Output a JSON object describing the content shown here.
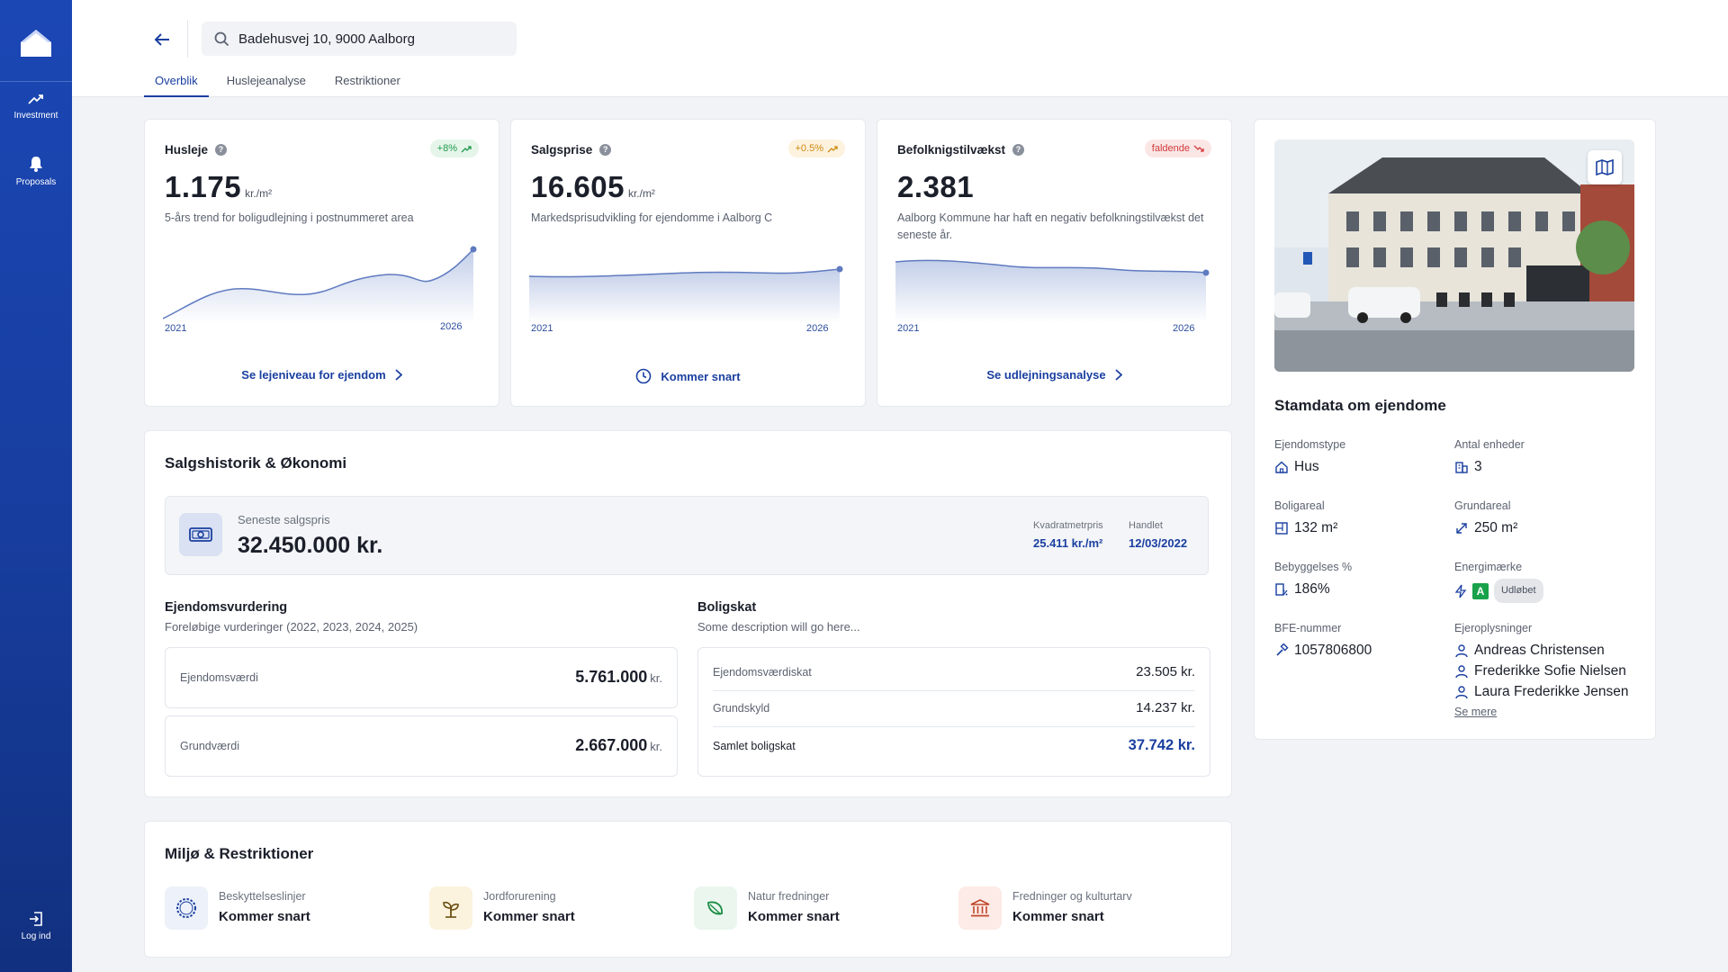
{
  "sidebar": {
    "items": [
      {
        "label": "Investment",
        "icon": "trend-up-icon"
      },
      {
        "label": "Proposals",
        "icon": "bell-icon"
      }
    ],
    "logout_label": "Log ind"
  },
  "header": {
    "search_value": "Badehusvej 10, 9000 Aalborg",
    "tabs": [
      "Overblik",
      "Huslejeanalyse",
      "Restriktioner"
    ],
    "active_tab": "Overblik"
  },
  "kpis": [
    {
      "title": "Husleje",
      "badge": "+8%",
      "badge_color": "#1f9a4a",
      "badge_bg": "#e5f5ea",
      "value": "1.175",
      "unit": "kr./m²",
      "desc": "5-års trend for boligudlejning i postnummeret area",
      "year_start": "2021",
      "year_end": "2026",
      "link": "Se lejeniveau for ejendom"
    },
    {
      "title": "Salgsprise",
      "badge": "+0.5%",
      "badge_color": "#d08a10",
      "badge_bg": "#fcf2de",
      "value": "16.605",
      "unit": "kr./m²",
      "desc": "Markedsprisudvikling for ejendomme i Aalborg C",
      "year_start": "2021",
      "year_end": "2026",
      "link": "Kommer snart"
    },
    {
      "title": "Befolknigstilvækst",
      "badge": "faldende",
      "badge_color": "#d23b3b",
      "badge_bg": "#fbe6e6",
      "value": "2.381",
      "unit": "",
      "desc": "Aalborg Kommune har haft en negativ befolkningstilvækst det seneste år.",
      "year_start": "2021",
      "year_end": "2026",
      "link": "Se udlejningsanalyse"
    }
  ],
  "sales": {
    "title": "Salgshistorik & Økonomi",
    "latest_label": "Seneste salgspris",
    "latest_value": "32.450.000 kr.",
    "sqm_label": "Kvadratmetrpris",
    "sqm_value": "25.411 kr./m²",
    "traded_label": "Handlet",
    "traded_value": "12/03/2022",
    "valuation": {
      "title": "Ejendomsvurdering",
      "desc": "Foreløbige vurderinger (2022, 2023, 2024, 2025)",
      "rows": [
        {
          "label": "Ejendomsværdi",
          "value": "5.761.000",
          "unit": "kr."
        },
        {
          "label": "Grundværdi",
          "value": "2.667.000",
          "unit": "kr."
        }
      ]
    },
    "tax": {
      "title": "Boligskat",
      "desc": "Some description will go here...",
      "rows": [
        {
          "label": "Ejendomsværdiskat",
          "value": "23.505 kr."
        },
        {
          "label": "Grundskyld",
          "value": "14.237 kr."
        }
      ],
      "total_label": "Samlet boligskat",
      "total_value": "37.742 kr."
    }
  },
  "environment": {
    "title": "Miljø & Restriktioner",
    "items": [
      {
        "label": "Beskyttelseslinjer",
        "value": "Kommer snart",
        "icon": "protection-line-icon"
      },
      {
        "label": "Jordforurening",
        "value": "Kommer snart",
        "icon": "sprout-icon"
      },
      {
        "label": "Natur fredninger",
        "value": "Kommer snart",
        "icon": "leaf-icon"
      },
      {
        "label": "Fredninger og kulturtarv",
        "value": "Kommer snart",
        "icon": "museum-icon"
      }
    ]
  },
  "property": {
    "title": "Stamdata om ejendome",
    "attrs": [
      {
        "label": "Ejendomstype",
        "value": "Hus",
        "icon": "house-icon"
      },
      {
        "label": "Antal enheder",
        "value": "3",
        "icon": "building-icon"
      },
      {
        "label": "Boligareal",
        "value": "132 m²",
        "icon": "floorplan-icon"
      },
      {
        "label": "Grundareal",
        "value": "250 m²",
        "icon": "resize-icon"
      },
      {
        "label": "Bebyggelses %",
        "value": "186%",
        "icon": "building-percent-icon"
      },
      {
        "label": "Energimærke",
        "value": "A",
        "icon": "lightning-icon",
        "status": "Udløbet"
      },
      {
        "label": "BFE-nummer",
        "value": "1057806800",
        "icon": "hammer-icon"
      }
    ],
    "owners_label": "Ejeroplysninger",
    "owners": [
      "Andreas Christensen",
      "Frederikke Sofie Nielsen",
      "Laura Frederikke Jensen"
    ],
    "see_more": "Se mere"
  },
  "colors": {
    "brand": "#1a3fa0",
    "sidebar": "#173d9e",
    "chart_line": "#5f7bc0"
  }
}
